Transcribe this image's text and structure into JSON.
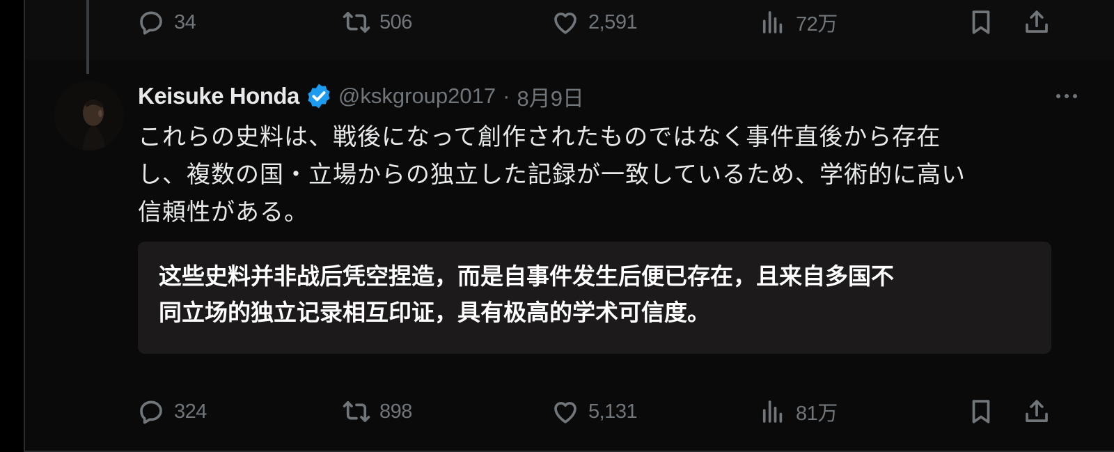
{
  "previous_tweet": {
    "actions": {
      "replies": "34",
      "retweets": "506",
      "likes": "2,591",
      "views": "72万"
    }
  },
  "tweet": {
    "author_name": "Keisuke Honda",
    "handle": "@kskgroup2017",
    "separator": "·",
    "date": "8月9日",
    "text_lines": [
      "これらの史料は、戦後になって創作されたものではなく事件直後から存在",
      "し、複数の国・立場からの独立した記録が一致しているため、学術的に高い",
      "信頼性がある。"
    ],
    "translation_lines": [
      "这些史料并非战后凭空捏造，而是自事件发生后便已存在，且来自多国不",
      "同立场的独立记录相互印证，具有极高的学术可信度。"
    ],
    "actions": {
      "replies": "324",
      "retweets": "898",
      "likes": "5,131",
      "views": "81万"
    }
  },
  "icons": {
    "reply": "reply-icon",
    "retweet": "retweet-icon",
    "like": "heart-icon",
    "views": "views-icon",
    "bookmark": "bookmark-icon",
    "share": "share-icon",
    "verified": "verified-badge-icon",
    "more": "more-icon"
  },
  "colors": {
    "background": "#000000",
    "text": "#e7e9ea",
    "muted": "#71767b",
    "verified": "#1d9bf0",
    "translation_bg": "#1c1a1a"
  }
}
